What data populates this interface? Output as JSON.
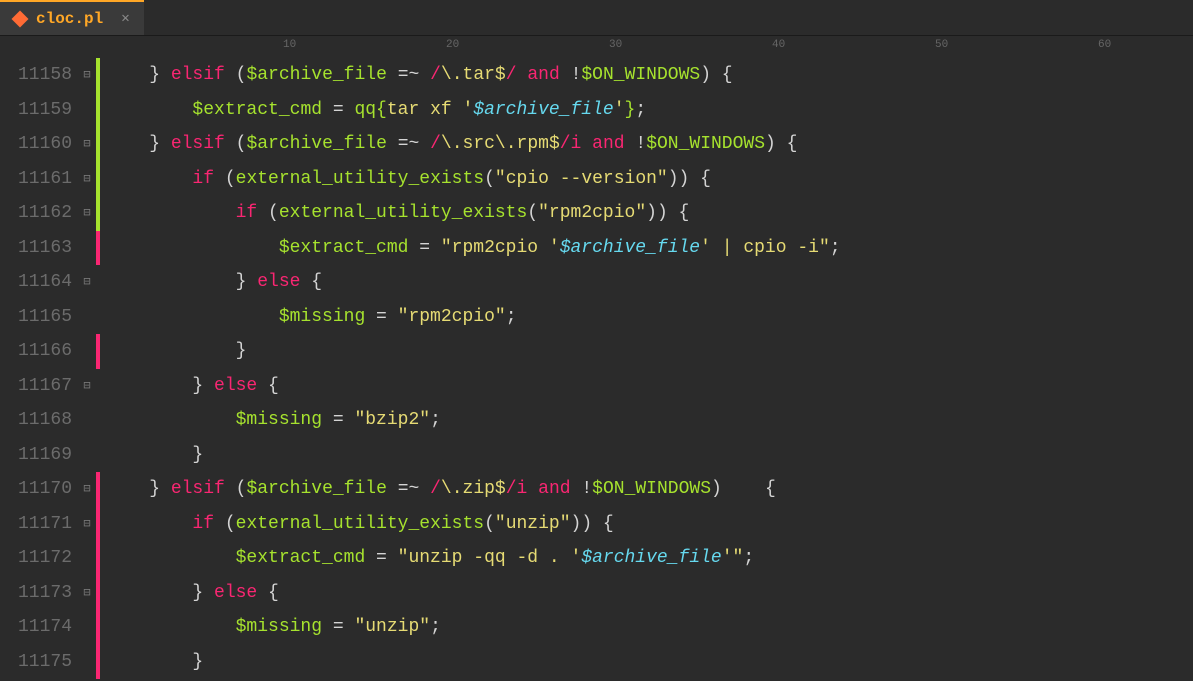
{
  "tab": {
    "label": "cloc.pl",
    "close": "✕"
  },
  "ruler": {
    "marks": [
      "10",
      "20",
      "30",
      "40",
      "50",
      "60"
    ]
  },
  "lines": {
    "start": 11158,
    "content": [
      {
        "n": "11158",
        "fold": "⊟",
        "diff": "add",
        "code": [
          {
            "t": "    ",
            "c": "p"
          },
          {
            "t": "} ",
            "c": "p"
          },
          {
            "t": "elsif",
            "c": "kw"
          },
          {
            "t": " (",
            "c": "p"
          },
          {
            "t": "$archive_file",
            "c": "id"
          },
          {
            "t": " =~ ",
            "c": "op"
          },
          {
            "t": "/",
            "c": "rg"
          },
          {
            "t": "\\.tar$",
            "c": "strin"
          },
          {
            "t": "/",
            "c": "rg"
          },
          {
            "t": " ",
            "c": "p"
          },
          {
            "t": "and",
            "c": "kw"
          },
          {
            "t": " !",
            "c": "op"
          },
          {
            "t": "$ON_WINDOWS",
            "c": "id"
          },
          {
            "t": ") {",
            "c": "p"
          }
        ]
      },
      {
        "n": "11159",
        "fold": "",
        "diff": "add",
        "code": [
          {
            "t": "        ",
            "c": "p"
          },
          {
            "t": "$extract_cmd",
            "c": "id"
          },
          {
            "t": " = ",
            "c": "op"
          },
          {
            "t": "qq{",
            "c": "qq"
          },
          {
            "t": "tar xf '",
            "c": "strin"
          },
          {
            "t": "$archive_file",
            "c": "varstr"
          },
          {
            "t": "'",
            "c": "strin"
          },
          {
            "t": "}",
            "c": "qq"
          },
          {
            "t": ";",
            "c": "p"
          }
        ]
      },
      {
        "n": "11160",
        "fold": "⊟",
        "diff": "add",
        "code": [
          {
            "t": "    ",
            "c": "p"
          },
          {
            "t": "} ",
            "c": "p"
          },
          {
            "t": "elsif",
            "c": "kw"
          },
          {
            "t": " (",
            "c": "p"
          },
          {
            "t": "$archive_file",
            "c": "id"
          },
          {
            "t": " =~ ",
            "c": "op"
          },
          {
            "t": "/",
            "c": "rg"
          },
          {
            "t": "\\.src\\.rpm$",
            "c": "strin"
          },
          {
            "t": "/i",
            "c": "rg"
          },
          {
            "t": " ",
            "c": "p"
          },
          {
            "t": "and",
            "c": "kw"
          },
          {
            "t": " !",
            "c": "op"
          },
          {
            "t": "$ON_WINDOWS",
            "c": "id"
          },
          {
            "t": ") {",
            "c": "p"
          }
        ]
      },
      {
        "n": "11161",
        "fold": "⊟",
        "diff": "add",
        "code": [
          {
            "t": "        ",
            "c": "p"
          },
          {
            "t": "if",
            "c": "kw"
          },
          {
            "t": " (",
            "c": "p"
          },
          {
            "t": "external_utility_exists",
            "c": "fn"
          },
          {
            "t": "(",
            "c": "p"
          },
          {
            "t": "\"cpio --version\"",
            "c": "str"
          },
          {
            "t": ")) {",
            "c": "p"
          }
        ]
      },
      {
        "n": "11162",
        "fold": "⊟",
        "diff": "add",
        "code": [
          {
            "t": "            ",
            "c": "p"
          },
          {
            "t": "if",
            "c": "kw"
          },
          {
            "t": " (",
            "c": "p"
          },
          {
            "t": "external_utility_exists",
            "c": "fn"
          },
          {
            "t": "(",
            "c": "p"
          },
          {
            "t": "\"rpm2cpio\"",
            "c": "str"
          },
          {
            "t": ")) {",
            "c": "p"
          }
        ]
      },
      {
        "n": "11163",
        "fold": "",
        "diff": "mod",
        "code": [
          {
            "t": "                ",
            "c": "p"
          },
          {
            "t": "$extract_cmd",
            "c": "id"
          },
          {
            "t": " = ",
            "c": "op"
          },
          {
            "t": "\"rpm2cpio '",
            "c": "str"
          },
          {
            "t": "$archive_file",
            "c": "varstr"
          },
          {
            "t": "' | cpio -i\"",
            "c": "str"
          },
          {
            "t": ";",
            "c": "p"
          }
        ]
      },
      {
        "n": "11164",
        "fold": "⊟",
        "diff": "",
        "code": [
          {
            "t": "            ",
            "c": "p"
          },
          {
            "t": "} ",
            "c": "p"
          },
          {
            "t": "else",
            "c": "kw"
          },
          {
            "t": " {",
            "c": "p"
          }
        ]
      },
      {
        "n": "11165",
        "fold": "",
        "diff": "",
        "code": [
          {
            "t": "                ",
            "c": "p"
          },
          {
            "t": "$missing",
            "c": "id"
          },
          {
            "t": " = ",
            "c": "op"
          },
          {
            "t": "\"rpm2cpio\"",
            "c": "str"
          },
          {
            "t": ";",
            "c": "p"
          }
        ]
      },
      {
        "n": "11166",
        "fold": "",
        "diff": "mod",
        "code": [
          {
            "t": "            ",
            "c": "p"
          },
          {
            "t": "}",
            "c": "p"
          }
        ]
      },
      {
        "n": "11167",
        "fold": "⊟",
        "diff": "",
        "code": [
          {
            "t": "        ",
            "c": "p"
          },
          {
            "t": "} ",
            "c": "p"
          },
          {
            "t": "else",
            "c": "kw"
          },
          {
            "t": " {",
            "c": "p"
          }
        ]
      },
      {
        "n": "11168",
        "fold": "",
        "diff": "",
        "code": [
          {
            "t": "            ",
            "c": "p"
          },
          {
            "t": "$missing",
            "c": "id"
          },
          {
            "t": " = ",
            "c": "op"
          },
          {
            "t": "\"bzip2\"",
            "c": "str"
          },
          {
            "t": ";",
            "c": "p"
          }
        ]
      },
      {
        "n": "11169",
        "fold": "",
        "diff": "",
        "code": [
          {
            "t": "        ",
            "c": "p"
          },
          {
            "t": "}",
            "c": "p"
          }
        ]
      },
      {
        "n": "11170",
        "fold": "⊟",
        "diff": "mod",
        "code": [
          {
            "t": "    ",
            "c": "p"
          },
          {
            "t": "} ",
            "c": "p"
          },
          {
            "t": "elsif",
            "c": "kw"
          },
          {
            "t": " (",
            "c": "p"
          },
          {
            "t": "$archive_file",
            "c": "id"
          },
          {
            "t": " =~ ",
            "c": "op"
          },
          {
            "t": "/",
            "c": "rg"
          },
          {
            "t": "\\.zip$",
            "c": "strin"
          },
          {
            "t": "/i",
            "c": "rg"
          },
          {
            "t": " ",
            "c": "p"
          },
          {
            "t": "and",
            "c": "kw"
          },
          {
            "t": " !",
            "c": "op"
          },
          {
            "t": "$ON_WINDOWS",
            "c": "id"
          },
          {
            "t": ")    {",
            "c": "p"
          }
        ]
      },
      {
        "n": "11171",
        "fold": "⊟",
        "diff": "mod",
        "code": [
          {
            "t": "        ",
            "c": "p"
          },
          {
            "t": "if",
            "c": "kw"
          },
          {
            "t": " (",
            "c": "p"
          },
          {
            "t": "external_utility_exists",
            "c": "fn"
          },
          {
            "t": "(",
            "c": "p"
          },
          {
            "t": "\"unzip\"",
            "c": "str"
          },
          {
            "t": ")) {",
            "c": "p"
          }
        ]
      },
      {
        "n": "11172",
        "fold": "",
        "diff": "mod",
        "code": [
          {
            "t": "            ",
            "c": "p"
          },
          {
            "t": "$extract_cmd",
            "c": "id"
          },
          {
            "t": " = ",
            "c": "op"
          },
          {
            "t": "\"unzip -qq -d . '",
            "c": "str"
          },
          {
            "t": "$archive_file",
            "c": "varstr"
          },
          {
            "t": "'\"",
            "c": "str"
          },
          {
            "t": ";",
            "c": "p"
          }
        ]
      },
      {
        "n": "11173",
        "fold": "⊟",
        "diff": "mod",
        "code": [
          {
            "t": "        ",
            "c": "p"
          },
          {
            "t": "} ",
            "c": "p"
          },
          {
            "t": "else",
            "c": "kw"
          },
          {
            "t": " {",
            "c": "p"
          }
        ]
      },
      {
        "n": "11174",
        "fold": "",
        "diff": "mod",
        "code": [
          {
            "t": "            ",
            "c": "p"
          },
          {
            "t": "$missing",
            "c": "id"
          },
          {
            "t": " = ",
            "c": "op"
          },
          {
            "t": "\"unzip\"",
            "c": "str"
          },
          {
            "t": ";",
            "c": "p"
          }
        ]
      },
      {
        "n": "11175",
        "fold": "",
        "diff": "mod",
        "code": [
          {
            "t": "        ",
            "c": "p"
          },
          {
            "t": "}",
            "c": "p"
          }
        ]
      }
    ]
  }
}
